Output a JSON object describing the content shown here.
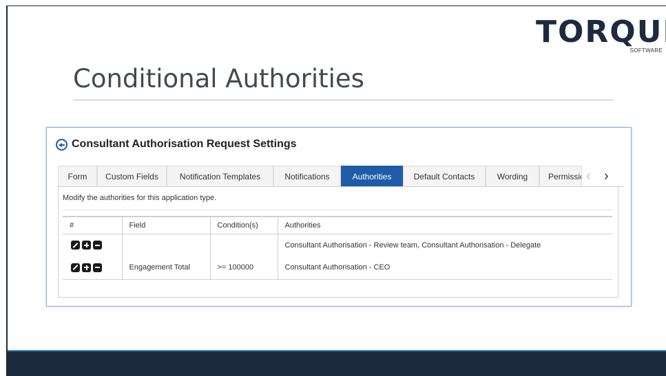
{
  "logo": {
    "name": "TORQUE",
    "sub": "SOFTWARE"
  },
  "slide": {
    "title": "Conditional Authorities"
  },
  "panel": {
    "title": "Consultant Authorisation Request Settings"
  },
  "tabs": [
    {
      "label": "Form",
      "active": false
    },
    {
      "label": "Custom Fields",
      "active": false
    },
    {
      "label": "Notification Templates",
      "active": false
    },
    {
      "label": "Notifications",
      "active": false
    },
    {
      "label": "Authorities",
      "active": true
    },
    {
      "label": "Default Contacts",
      "active": false
    },
    {
      "label": "Wording",
      "active": false
    },
    {
      "label": "Permissic",
      "active": false
    }
  ],
  "tab_nav": {
    "prev": "‹",
    "next": "›"
  },
  "content": {
    "description": "Modify the authorities for this application type."
  },
  "table": {
    "headers": [
      "#",
      "Field",
      "Condition(s)",
      "Authorities"
    ],
    "rows": [
      {
        "field": "",
        "condition": "",
        "authorities": "Consultant Authorisation - Review team, Consultant Authorisation - Delegate"
      },
      {
        "field": "Engagement Total",
        "condition": ">= 100000",
        "authorities": "Consultant Authorisation - CEO"
      }
    ]
  },
  "row_icons": [
    "edit-icon",
    "plus-icon",
    "minus-icon"
  ],
  "colors": {
    "accent": "#1e5ba8",
    "dark_navy": "#1c2b3e",
    "footer_line": "#4a8fd6"
  }
}
